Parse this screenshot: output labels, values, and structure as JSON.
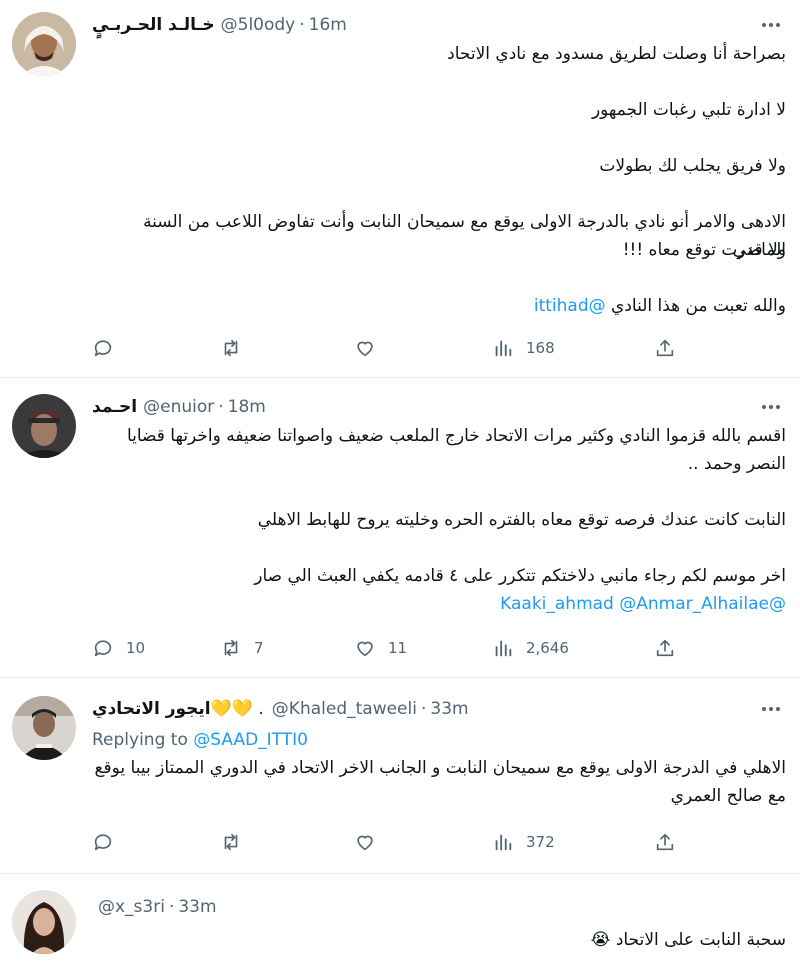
{
  "tweets": [
    {
      "display_name": "خـالـد الحـربـيٍ",
      "handle": "@5l0ody",
      "time": "16m",
      "lines": [
        "بصراحة أنا وصلت لطريق مسدود مع نادي الاتحاد",
        "",
        "لا ادارة تلبي رغبات الجمهور",
        "",
        "ولا فريق يجلب لك بطولات",
        "",
        "الادهى والامر أنو نادي بالدرجة الاولى يوقع مع سميحان النابت وأنت تفاوض اللاعب من السنة الماضي",
        "ولا قدرت توقع معاه !!!",
        ""
      ],
      "last_line_text": "والله تعبت من هذا النادي",
      "last_line_mention": "@ittihad",
      "counts": {
        "reply": "",
        "retweet": "",
        "like": "",
        "views": "168"
      }
    },
    {
      "display_name": "احـمد",
      "handle": "@enuior",
      "time": "18m",
      "lines": [
        "اقسم بالله قزموا النادي وكثير مرات الاتحاد خارج الملعب ضعيف واصواتنا ضعيفه واخرتها قضايا",
        "النصر وحمد ..",
        "",
        "النابت كانت عندك فرصه توقع معاه بالفتره الحره وخليته يروح للهابط الاهلي",
        "",
        "اخر موسم لكم رجاء مانبي دلاختكم تتكرر على ٤ قادمه يكفي العبث الي صار"
      ],
      "mentions": "@Kaaki_ahmad @Anmar_Alhailae",
      "counts": {
        "reply": "10",
        "retweet": "7",
        "like": "11",
        "views": "2,646"
      }
    },
    {
      "display_name": "ايجور الاتحادي",
      "hearts": "💛💛 .",
      "handle": "@Khaled_taweeli",
      "time": "33m",
      "replying_label": "Replying to",
      "replying_handle": "@SAAD_ITTI0",
      "lines": [
        "الاهلي في الدرجة الاولى يوقع مع سميحان النابت و الجانب الاخر الاتحاد في الدوري الممتاز بيبا يوقع",
        "مع صالح العمري"
      ],
      "counts": {
        "reply": "",
        "retweet": "",
        "like": "",
        "views": "372"
      }
    },
    {
      "display_name": "",
      "handle": "@x_s3ri",
      "time": "33m",
      "lines": [
        "سحبة النابت على الاتحاد 😭"
      ]
    }
  ],
  "separator": "·",
  "colors": {
    "text": "#0f1419",
    "secondary": "#536471",
    "link": "#1d9bf0",
    "border": "#e7e9ea"
  },
  "icons": [
    "reply-icon",
    "retweet-icon",
    "like-icon",
    "views-icon",
    "share-icon",
    "more-icon"
  ]
}
